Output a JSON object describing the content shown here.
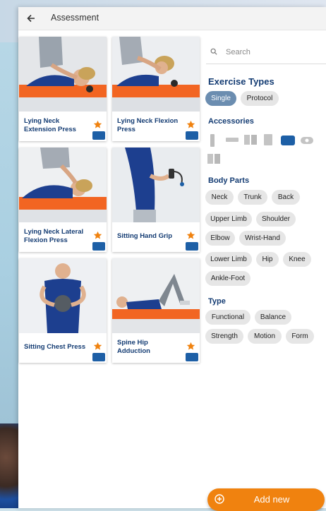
{
  "window": {
    "title": "Assessment",
    "back_icon": "arrow-left-icon"
  },
  "exercises": [
    {
      "name": "Lying Neck Extension Press"
    },
    {
      "name": "Lying Neck Flexion Press"
    },
    {
      "name": "Lying Neck Lateral Flexion Press"
    },
    {
      "name": "Sitting Hand Grip"
    },
    {
      "name": "Sitting Chest Press"
    },
    {
      "name": "Spine Hip Adduction"
    }
  ],
  "search": {
    "placeholder": "Search"
  },
  "filters": {
    "exercise_types": {
      "title": "Exercise Types",
      "options": [
        "Single",
        "Protocol"
      ],
      "selected": "Single"
    },
    "accessories": {
      "title": "Accessories",
      "icons": [
        "foam-roller-icon",
        "bar-icon",
        "block-icon",
        "pad-icon",
        "cushion-icon",
        "band-icon",
        "mat-icon"
      ],
      "selected_index": 4
    },
    "body_parts": {
      "title": "Body Parts",
      "options": [
        "Neck",
        "Trunk",
        "Back",
        "Upper Limb",
        "Shoulder",
        "Elbow",
        "Wrist-Hand",
        "Lower Limb",
        "Hip",
        "Knee",
        "Ankle-Foot"
      ]
    },
    "type": {
      "title": "Type",
      "options": [
        "Functional",
        "Balance",
        "Strength",
        "Motion",
        "Form"
      ]
    }
  },
  "actions": {
    "add_new": "Add new"
  },
  "colors": {
    "accent": "#f0820f",
    "heading": "#143c73",
    "selected_chip": "#6b8db0",
    "mat_orange": "#f26522",
    "shirt_blue": "#1d3f8f"
  }
}
